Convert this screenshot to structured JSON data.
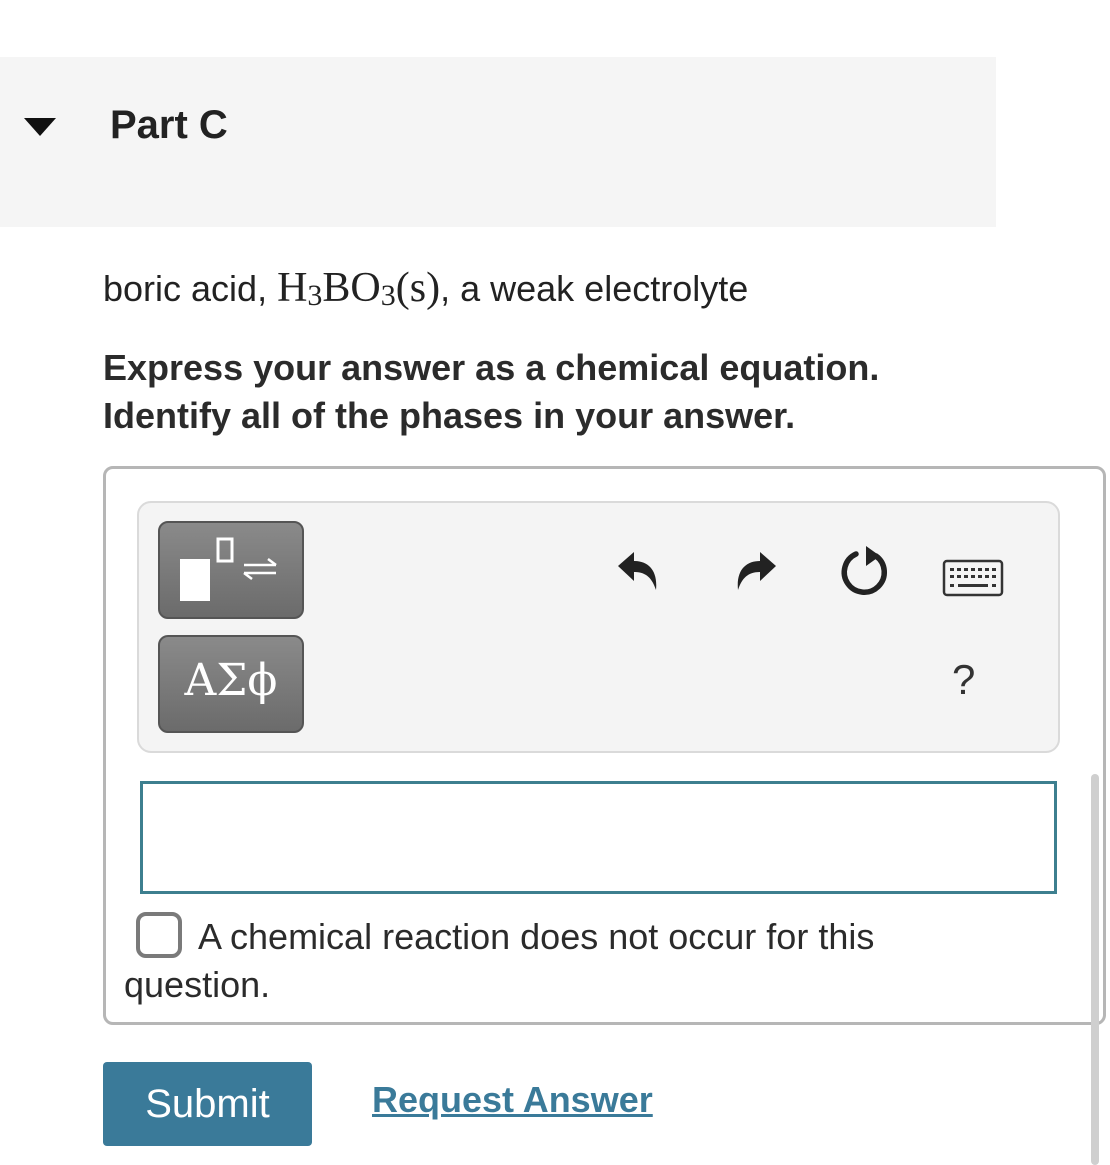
{
  "part": {
    "title": "Part C",
    "collapse_icon": "triangle-down-icon"
  },
  "question": {
    "prompt_prefix": "boric acid, ",
    "formula": {
      "h": "H",
      "h_sub": "3",
      "bo": "BO",
      "bo_sub": "3",
      "phase": "(s)"
    },
    "prompt_suffix": ", a weak electrolyte",
    "instructions_line1": "Express your answer as a chemical equation.",
    "instructions_line2": "Identify all of the phases in your answer."
  },
  "toolbar": {
    "templates_icon": "templates-icon",
    "symbols_label": "ΑΣϕ",
    "undo_icon": "undo-icon",
    "redo_icon": "redo-icon",
    "reset_icon": "reset-icon",
    "keyboard_icon": "keyboard-icon",
    "help_label": "?"
  },
  "answer": {
    "value": "",
    "no_reaction_label": "A chemical reaction does not occur for this question.",
    "no_reaction_checked": false
  },
  "actions": {
    "submit_label": "Submit",
    "request_answer_label": "Request Answer"
  },
  "colors": {
    "accent": "#3a7a99",
    "input_border": "#3d7f8f",
    "header_bg": "#f5f5f5",
    "toolbar_bg": "#f4f4f4",
    "tool_button": "#7b7b7b"
  }
}
